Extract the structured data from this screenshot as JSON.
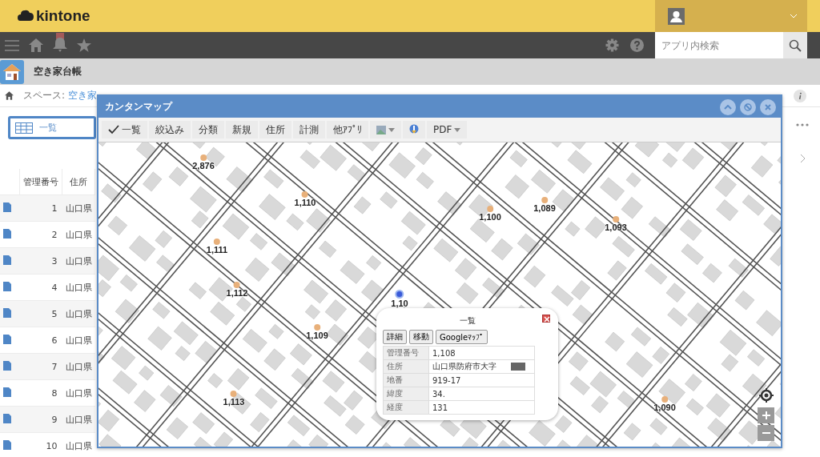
{
  "header": {
    "logo": "kintone"
  },
  "nav": {
    "search": {
      "placeholder": "アプリ内検索"
    }
  },
  "app": {
    "title": "空き家台帳"
  },
  "breadcrumb": {
    "label": "スペース:",
    "link": "空き家"
  },
  "view": {
    "label": "一覧"
  },
  "table": {
    "columns": [
      "管理番号",
      "住所"
    ],
    "rows": [
      {
        "number": "1",
        "address": "山口県"
      },
      {
        "number": "2",
        "address": "山口県"
      },
      {
        "number": "3",
        "address": "山口県"
      },
      {
        "number": "4",
        "address": "山口県"
      },
      {
        "number": "5",
        "address": "山口県"
      },
      {
        "number": "6",
        "address": "山口県"
      },
      {
        "number": "7",
        "address": "山口県"
      },
      {
        "number": "8",
        "address": "山口県"
      },
      {
        "number": "9",
        "address": "山口県"
      },
      {
        "number": "10",
        "address": "山口県"
      }
    ]
  },
  "map_window": {
    "title": "カンタンマップ",
    "toolbar": [
      {
        "kind": "check",
        "label": "一覧",
        "checked": true
      },
      {
        "kind": "button",
        "label": "絞込み"
      },
      {
        "kind": "button",
        "label": "分類"
      },
      {
        "kind": "button",
        "label": "新規"
      },
      {
        "kind": "button",
        "label": "住所"
      },
      {
        "kind": "button",
        "label": "計測"
      },
      {
        "kind": "button",
        "label": "他ｱﾌﾟﾘ"
      },
      {
        "kind": "layer"
      },
      {
        "kind": "pin"
      },
      {
        "kind": "dropdown",
        "label": "PDF"
      }
    ],
    "markers": [
      {
        "label": "2,876",
        "selected": false
      },
      {
        "label": "1,110",
        "selected": false
      },
      {
        "label": "1,100",
        "selected": false
      },
      {
        "label": "1,089",
        "selected": false
      },
      {
        "label": "1,093",
        "selected": false
      },
      {
        "label": "1,111",
        "selected": false
      },
      {
        "label": "1,112",
        "selected": false
      },
      {
        "label": "1,10",
        "selected": true
      },
      {
        "label": "1,109",
        "selected": false
      },
      {
        "label": "1,113",
        "selected": false
      },
      {
        "label": "1,090",
        "selected": false
      }
    ],
    "popup": {
      "title": "一覧",
      "buttons": [
        "詳細",
        "移動",
        "Googleﾏｯﾌﾟ"
      ],
      "fields": [
        {
          "label": "管理番号",
          "value": "1,108"
        },
        {
          "label": "住所",
          "value": "山口県防府市大字",
          "redacted": true
        },
        {
          "label": "地番",
          "value": "919-17"
        },
        {
          "label": "緯度",
          "value": "34."
        },
        {
          "label": "経度",
          "value": "131"
        }
      ]
    }
  }
}
